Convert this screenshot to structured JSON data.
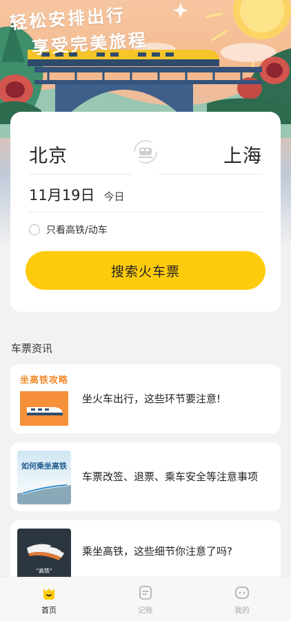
{
  "banner": {
    "slogan_line1": "轻松安排出行",
    "slogan_line2": "享受完美旅程"
  },
  "search": {
    "from_city": "北京",
    "to_city": "上海",
    "date": "11月19日",
    "date_hint": "今日",
    "filter_label": "只看高铁/动车",
    "filter_checked": false,
    "button_label": "搜索火车票",
    "accent_color": "#fecb0c"
  },
  "news": {
    "section_title": "车票资讯",
    "items": [
      {
        "title": "坐火车出行，这些环节要注意!",
        "thumb_text": "坐高铁攻略",
        "thumb_icon": "train-photo"
      },
      {
        "title": "车票改签、退票、乘车安全等注意事项",
        "thumb_text": "如何乘坐高铁",
        "thumb_icon": "train-photo"
      },
      {
        "title": "乘坐高铁，这些细节你注意了吗?",
        "thumb_text": "\"高铁\"",
        "thumb_icon": "train-illustration"
      }
    ]
  },
  "tabbar": {
    "tabs": [
      {
        "label": "首页",
        "icon": "home-face-icon",
        "active": true
      },
      {
        "label": "记账",
        "icon": "notes-icon",
        "active": false
      },
      {
        "label": "我的",
        "icon": "profile-face-icon",
        "active": false
      }
    ]
  }
}
